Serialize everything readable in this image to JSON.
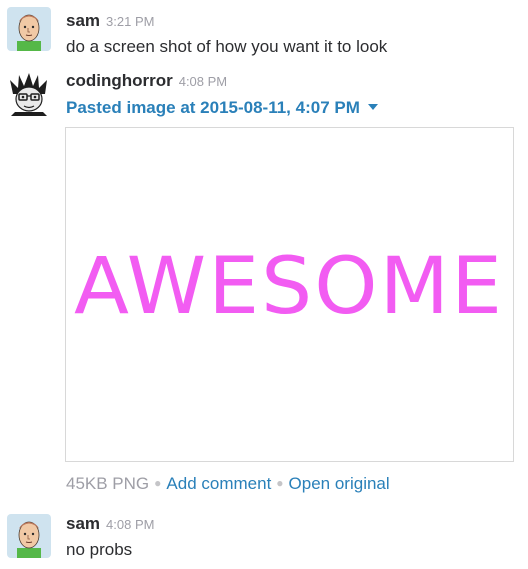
{
  "messages": [
    {
      "avatar": "sam-avatar",
      "username": "sam",
      "time": "3:21 PM",
      "text": "do a screen shot of how you want it to look"
    },
    {
      "avatar": "codinghorror-avatar",
      "username": "codinghorror",
      "time": "4:08 PM",
      "attachment": {
        "title": "Pasted image at 2015-08-11, 4:07 PM",
        "image_text": "AWESOME",
        "image_text_color": "#f25cf2",
        "size": "45KB PNG",
        "add_comment": "Add comment",
        "open_original": "Open original"
      }
    },
    {
      "avatar": "sam-avatar",
      "username": "sam",
      "time": "4:08 PM",
      "text": "no probs"
    }
  ],
  "colors": {
    "link": "#2a80b9",
    "muted": "#9e9ea6",
    "text": "#2c2d30"
  }
}
